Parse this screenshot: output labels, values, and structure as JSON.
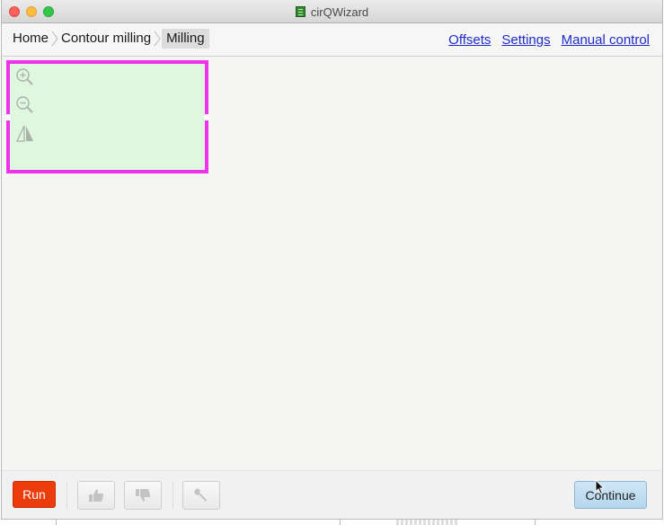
{
  "window": {
    "title": "cirQWizard"
  },
  "breadcrumb": {
    "items": [
      {
        "label": "Home"
      },
      {
        "label": "Contour milling"
      },
      {
        "label": "Milling"
      }
    ]
  },
  "navlinks": {
    "offsets": "Offsets",
    "settings": "Settings",
    "manual_control": "Manual control"
  },
  "toolbar": {
    "run_label": "Run",
    "continue_label": "Continue"
  },
  "icons": {
    "zoom_in": "zoom-in-icon",
    "zoom_out": "zoom-out-icon",
    "flip": "flip-horizontal-icon",
    "thumbs_up": "thumbs-up-icon",
    "thumbs_down": "thumbs-down-icon",
    "wrench": "wrench-icon"
  },
  "colors": {
    "run_button": "#ec3c0b",
    "continue_button": "#b5d6ee",
    "preview_border": "#ee33ea",
    "preview_fill": "#dff6df",
    "link": "#1f2ccc"
  }
}
